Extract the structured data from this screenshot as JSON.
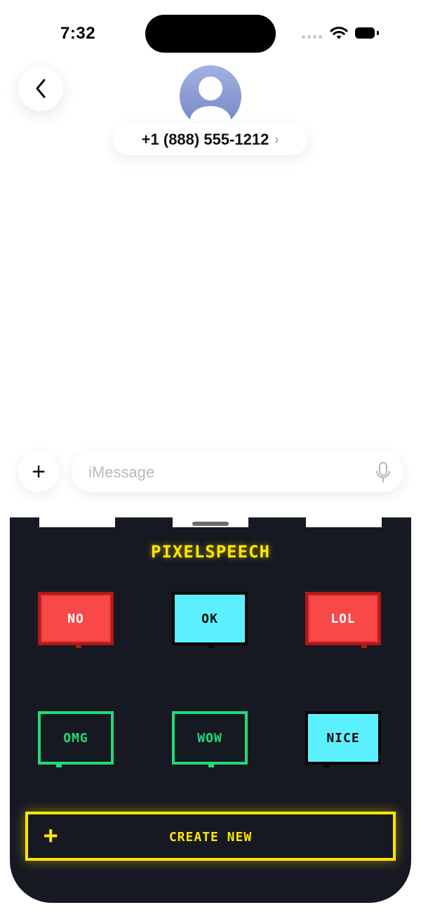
{
  "status_bar": {
    "time": "7:32",
    "icons": [
      "cellular-signal-icon",
      "wifi-icon",
      "battery-icon"
    ]
  },
  "header": {
    "back_icon": "chevron-left-icon",
    "avatar_icon": "person-silhouette-icon",
    "contact": "+1 (888) 555-1212",
    "contact_chevron": "›"
  },
  "composer": {
    "plus_label": "+",
    "placeholder": "iMessage",
    "mic_icon": "microphone-icon"
  },
  "app": {
    "title": "PIXELSPEECH",
    "stickers": [
      {
        "label": "NO",
        "style": "red"
      },
      {
        "label": "OK",
        "style": "cyan"
      },
      {
        "label": "LOL",
        "style": "red"
      },
      {
        "label": "OMG",
        "style": "green"
      },
      {
        "label": "WOW",
        "style": "green"
      },
      {
        "label": "NICE",
        "style": "cyan"
      }
    ],
    "create_plus": "+",
    "create_label": "CREATE NEW"
  },
  "colors": {
    "panel_bg": "#171922",
    "accent_yellow": "#ffe600",
    "red": "#f84848",
    "cyan": "#5cf0ff",
    "green": "#22d97a",
    "avatar": "#8e9dd4"
  }
}
